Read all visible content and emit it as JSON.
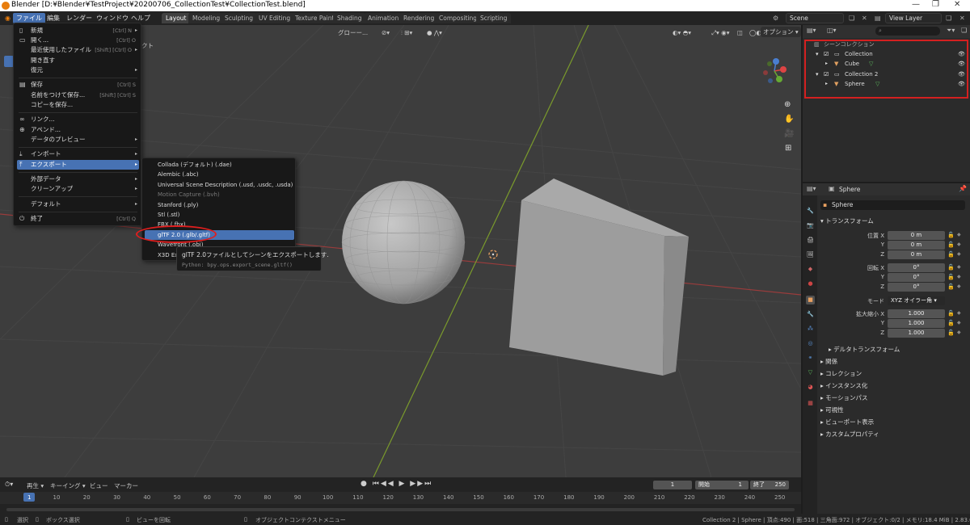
{
  "window": {
    "title": "Blender [D:¥Blender¥TestProject¥20200706_CollectionTest¥CollectionTest.blend]"
  },
  "menubar": {
    "menus": [
      "ファイル",
      "編集",
      "レンダー",
      "ウィンドウ",
      "ヘルプ"
    ],
    "workspaces": [
      "Layout",
      "Modeling",
      "Sculpting",
      "UV Editing",
      "Texture Paint",
      "Shading",
      "Animation",
      "Rendering",
      "Compositing",
      "Scripting"
    ],
    "scene": "Scene",
    "view_layer": "View Layer"
  },
  "viewport": {
    "orientation": "グローー...",
    "options_label": "オプション",
    "object_label": "ジェクト"
  },
  "file_menu": {
    "items": [
      {
        "label": "新規",
        "shortcut": "[Ctrl] N",
        "arrow": true
      },
      {
        "label": "開く...",
        "shortcut": "[Ctrl] O"
      },
      {
        "label": "最近使用したファイル",
        "shortcut": "[Shift] [Ctrl] O",
        "arrow": true
      },
      {
        "label": "開き直す"
      },
      {
        "label": "復元",
        "arrow": true
      },
      {
        "label": "保存",
        "shortcut": "[Ctrl] S"
      },
      {
        "label": "名前をつけて保存...",
        "shortcut": "[Shift] [Ctrl] S"
      },
      {
        "label": "コピーを保存..."
      },
      {
        "label": "リンク..."
      },
      {
        "label": "アペンド..."
      },
      {
        "label": "データのプレビュー",
        "arrow": true
      },
      {
        "label": "インポート",
        "arrow": true
      },
      {
        "label": "エクスポート",
        "arrow": true
      },
      {
        "label": "外部データ",
        "arrow": true
      },
      {
        "label": "クリーンアップ",
        "arrow": true
      },
      {
        "label": "デフォルト",
        "arrow": true
      },
      {
        "label": "終了",
        "shortcut": "[Ctrl] Q"
      }
    ]
  },
  "export_menu": {
    "items": [
      {
        "label": "Collada (デフォルト) (.dae)"
      },
      {
        "label": "Alembic (.abc)"
      },
      {
        "label": "Universal Scene Description (.usd, .usdc, .usda)"
      },
      {
        "label": "Motion Capture (.bvh)"
      },
      {
        "label": "Stanford (.ply)"
      },
      {
        "label": "Stl (.stl)"
      },
      {
        "label": "FBX (.fbx)"
      },
      {
        "label": "glTF 2.0 (.glb/.gltf)"
      },
      {
        "label": "Wavefront (.obj)"
      },
      {
        "label": "X3D Ex"
      }
    ],
    "tooltip_title": "glTF 2.0ファイルとしてシーンをエクスポートします.",
    "tooltip_python": "Python: bpy.ops.export_scene.gltf()"
  },
  "outliner": {
    "root": "シーンコレクション",
    "rows": [
      {
        "label": "Collection",
        "indent": 0
      },
      {
        "label": "Cube",
        "indent": 1
      },
      {
        "label": "Collection 2",
        "indent": 0
      },
      {
        "label": "Sphere",
        "indent": 1
      }
    ]
  },
  "properties": {
    "object_name": "Sphere",
    "transform_label": "トランスフォーム",
    "location_label": "位置 X",
    "location": [
      "0 m",
      "0 m",
      "0 m"
    ],
    "rotation_label": "回転 X",
    "rotation": [
      "0°",
      "0°",
      "0°"
    ],
    "mode_label": "モード",
    "mode_value": "XYZ オイラー角",
    "scale_label": "拡大縮小 X",
    "scale": [
      "1.000",
      "1.000",
      "1.000"
    ],
    "axis_y": "Y",
    "axis_z": "Z",
    "delta": "デルタトランスフォーム",
    "sections": [
      "関係",
      "コレクション",
      "インスタンス化",
      "モーションパス",
      "可視性",
      "ビューポート表示",
      "カスタムプロパティ"
    ]
  },
  "timeline": {
    "menus": [
      "再生",
      "キーイング",
      "ビュー",
      "マーカー"
    ],
    "current_frame": "1",
    "start_label": "開始",
    "start": "1",
    "end_label": "終了",
    "end": "250",
    "ticks": [
      "1",
      "10",
      "20",
      "30",
      "40",
      "50",
      "60",
      "70",
      "80",
      "90",
      "100",
      "110",
      "120",
      "130",
      "140",
      "150",
      "160",
      "170",
      "180",
      "190",
      "200",
      "210",
      "220",
      "230",
      "240",
      "250"
    ]
  },
  "statusbar": {
    "select": "選択",
    "box_select": "ボックス選択",
    "rotate_view": "ビューを回転",
    "context_menu": "オブジェクトコンテクストメニュー",
    "stats": "Collection 2 | Sphere | 頂点:490 | 面:518 | 三角面:972 | オブジェクト:0/2 | メモリ:18.4 MiB | 2.83.0"
  }
}
